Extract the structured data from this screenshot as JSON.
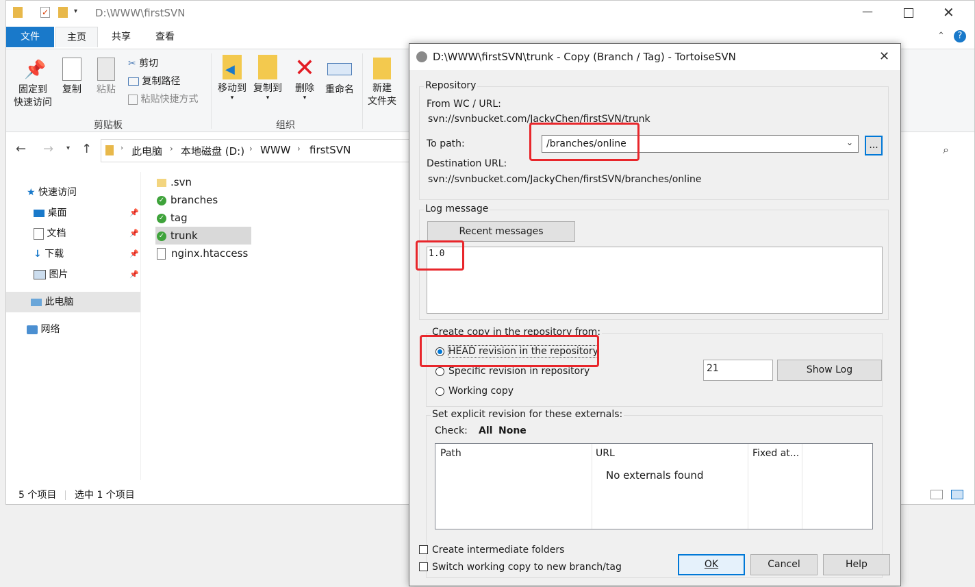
{
  "explorer": {
    "title_path": "D:\\WWW\\firstSVN",
    "tabs": [
      "文件",
      "主页",
      "共享",
      "查看"
    ],
    "clipboard": {
      "pin_label_1": "固定到",
      "pin_label_2": "快速访问",
      "copy": "复制",
      "paste": "粘贴",
      "cut": "剪切",
      "copy_path": "复制路径",
      "paste_shortcut": "粘贴快捷方式",
      "group": "剪贴板"
    },
    "organize": {
      "move_to": "移动到",
      "copy_to": "复制到",
      "delete": "删除",
      "rename": "重命名",
      "group": "组织"
    },
    "new": {
      "new_folder_1": "新建",
      "new_folder_2": "文件夹"
    },
    "breadcrumb": [
      "此电脑",
      "本地磁盘 (D:)",
      "WWW",
      "firstSVN"
    ],
    "nav": {
      "quick_access": "快速访问",
      "desktop": "桌面",
      "documents": "文档",
      "downloads": "下载",
      "pictures": "图片",
      "this_pc": "此电脑",
      "network": "网络"
    },
    "files": [
      ".svn",
      "branches",
      "tag",
      "trunk",
      "nginx.htaccess"
    ],
    "status": {
      "count": "5 个项目",
      "selected": "选中 1 个项目"
    }
  },
  "dialog": {
    "title": "D:\\WWW\\firstSVN\\trunk - Copy (Branch / Tag) - TortoiseSVN",
    "repository_group": "Repository",
    "from_label": "From WC / URL:",
    "from_value": "svn://svnbucket.com/JackyChen/firstSVN/trunk",
    "to_label": "To path:",
    "to_value": "/branches/online",
    "browse_button": "...",
    "dest_label": "Destination URL:",
    "dest_value": "svn://svnbucket.com/JackyChen/firstSVN/branches/online",
    "log_group": "Log message",
    "recent_button": "Recent messages",
    "log_text": "1.0",
    "copy_from_group": "Create copy in the repository from:",
    "opt_head": "HEAD revision in the repository",
    "opt_specific": "Specific revision in repository",
    "opt_working": "Working copy",
    "revision_value": "21",
    "show_log_button": "Show Log",
    "externals_group": "Set explicit revision for these externals:",
    "check_label": "Check:",
    "check_all": "All",
    "check_none": "None",
    "table_headers": [
      "Path",
      "URL",
      "Fixed at..."
    ],
    "table_empty": "No externals found",
    "chk_intermediate": "Create intermediate folders",
    "chk_switch": "Switch working copy to new branch/tag",
    "ok_button": "OK",
    "cancel_button": "Cancel",
    "help_button": "Help"
  },
  "colors": {
    "accent": "#0078d7",
    "file_tab": "#1979ca",
    "highlight": "#e8262b",
    "svn_green": "#3fa33b"
  }
}
